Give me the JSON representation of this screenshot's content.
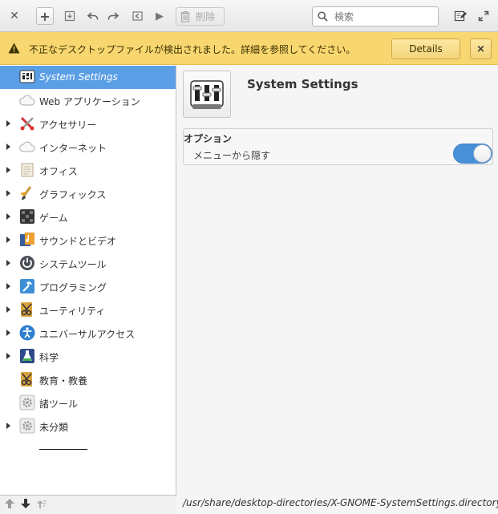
{
  "toolbar": {
    "close_icon": "close-icon",
    "add_icon": "plus-icon",
    "delete_label": "削除",
    "search_placeholder": "検索"
  },
  "infobar": {
    "message": "不正なデスクトップファイルが検出されました。詳細を参照してください。",
    "details_label": "Details",
    "close_label": "×"
  },
  "sidebar": {
    "items": [
      {
        "label": "System Settings",
        "icon": "system-settings-icon",
        "expander": false,
        "selected": true
      },
      {
        "label": "Web アプリケーション",
        "icon": "cloud-icon",
        "expander": false
      },
      {
        "label": "アクセサリー",
        "icon": "accessories-icon",
        "expander": true
      },
      {
        "label": "インターネット",
        "icon": "cloud-icon",
        "expander": true
      },
      {
        "label": "オフィス",
        "icon": "office-icon",
        "expander": true
      },
      {
        "label": "グラフィックス",
        "icon": "graphics-icon",
        "expander": true
      },
      {
        "label": "ゲーム",
        "icon": "games-icon",
        "expander": true
      },
      {
        "label": "サウンドとビデオ",
        "icon": "multimedia-icon",
        "expander": true
      },
      {
        "label": "システムツール",
        "icon": "power-icon",
        "expander": true
      },
      {
        "label": "プログラミング",
        "icon": "hammer-icon",
        "expander": true
      },
      {
        "label": "ユーティリティ",
        "icon": "utilities-icon",
        "expander": true
      },
      {
        "label": "ユニバーサルアクセス",
        "icon": "accessibility-icon",
        "expander": true
      },
      {
        "label": "科学",
        "icon": "science-icon",
        "expander": true
      },
      {
        "label": "教育・教養",
        "icon": "education-icon",
        "expander": false
      },
      {
        "label": "諸ツール",
        "icon": "gear-icon",
        "expander": false
      },
      {
        "label": "未分類",
        "icon": "gear-icon",
        "expander": true
      }
    ]
  },
  "main": {
    "title": "System Settings",
    "options_title": "オプション",
    "hide_from_menu_label": "メニューから隠す",
    "hide_from_menu_on": true,
    "file_path": "/usr/share/desktop-directories/X-GNOME-SystemSettings.directory"
  },
  "colors": {
    "selection": "#5a9fe6",
    "infobar": "#f9d770",
    "toggle": "#4a90d9"
  }
}
